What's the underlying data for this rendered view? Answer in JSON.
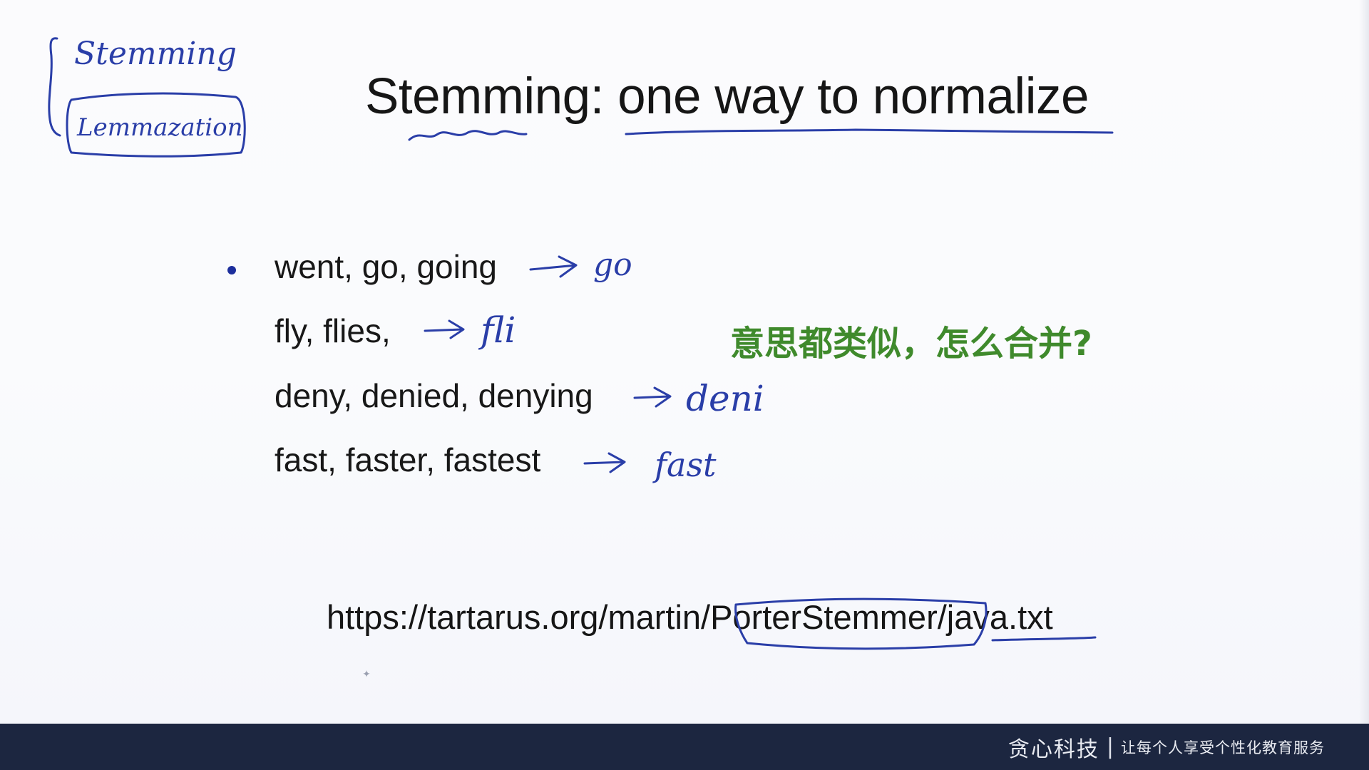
{
  "slide": {
    "title_part1": "Stemming:",
    "title_part2": " one way to normalize",
    "lines": [
      "went, go, going",
      "fly, flies,",
      "deny, denied, denying",
      "fast, faster, fastest"
    ],
    "question": "意思都类似，怎么合并?",
    "url_part1": "https://tartarus.org/martin/",
    "url_part2": "PorterStemmer",
    "url_part3": "/java.txt"
  },
  "annotations": {
    "stemming": "Stemming",
    "lemmatization": "Lemmazation",
    "go": "go",
    "fli": "fli",
    "deni": "deni",
    "fast": "fast"
  },
  "footer": {
    "brand": "贪心科技",
    "separator": "|",
    "slogan": "让每个人享受个性化教育服务"
  },
  "colors": {
    "ink": "#2a3ea8",
    "question": "#3f8a2c",
    "footer_bg": "#1c2640"
  }
}
